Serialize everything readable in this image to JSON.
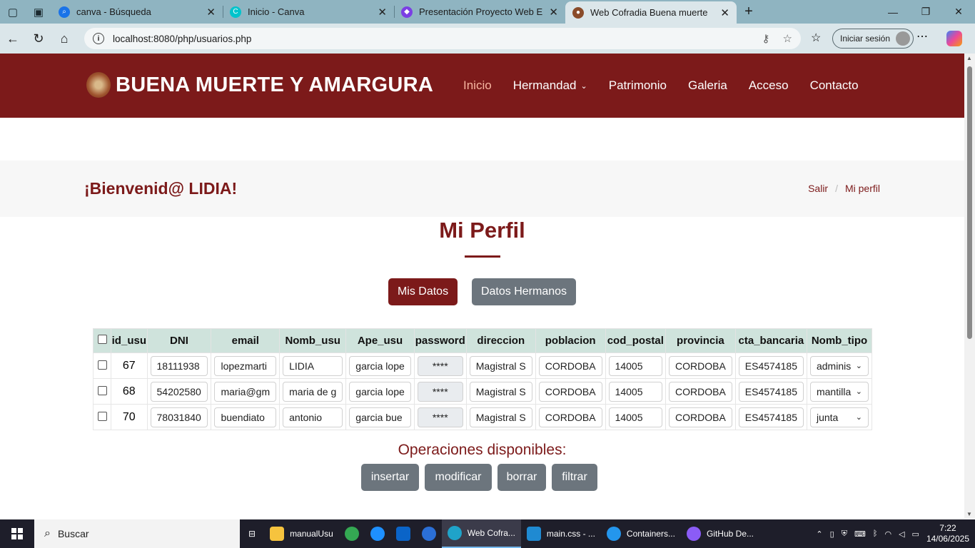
{
  "browser": {
    "tabs": [
      {
        "title": "canva - Búsqueda",
        "favicon": "search-icon",
        "color": "#1a73e8"
      },
      {
        "title": "Inicio - Canva",
        "favicon": "canva-icon",
        "color": "#00c4cc"
      },
      {
        "title": "Presentación Proyecto Web Elega",
        "favicon": "canva-presentation-icon",
        "color": "#7b3fe4"
      },
      {
        "title": "Web Cofradia Buena muerte",
        "favicon": "cofradia-icon",
        "color": "#8a4b2a"
      }
    ],
    "url": "localhost:8080/php/usuarios.php",
    "signin_label": "Iniciar sesión"
  },
  "site": {
    "brand": "BUENA MUERTE Y AMARGURA",
    "nav": [
      "Inicio",
      "Hermandad",
      "Patrimonio",
      "Galeria",
      "Acceso",
      "Contacto"
    ],
    "welcome": "¡Bienvenid@ LIDIA!",
    "breadcrumb": [
      "Salir",
      "Mi perfil"
    ],
    "page_title": "Mi Perfil",
    "tab_buttons": [
      "Mis Datos",
      "Datos Hermanos"
    ],
    "ops_title": "Operaciones disponibles:",
    "ops": [
      "insertar",
      "modificar",
      "borrar",
      "filtrar"
    ],
    "accent_color": "#7c1a1a"
  },
  "table": {
    "headers": [
      "id_usu",
      "DNI",
      "email",
      "Nomb_usu",
      "Ape_usu",
      "password",
      "direccion",
      "poblacion",
      "cod_postal",
      "provincia",
      "cta_bancaria",
      "Nomb_tipo"
    ],
    "rows": [
      {
        "id": "67",
        "dni": "18111938",
        "email": "lopezmarti",
        "nombre": "LIDIA",
        "apellido": "garcia lope",
        "password": "****",
        "direccion": "Magistral S",
        "poblacion": "CORDOBA",
        "cp": "14005",
        "provincia": "CORDOBA",
        "cuenta": "ES4574185",
        "tipo": "adminis"
      },
      {
        "id": "68",
        "dni": "54202580",
        "email": "maria@gm",
        "nombre": "maria de g",
        "apellido": "garcia lope",
        "password": "****",
        "direccion": "Magistral S",
        "poblacion": "CORDOBA",
        "cp": "14005",
        "provincia": "CORDOBA",
        "cuenta": "ES4574185",
        "tipo": "mantilla"
      },
      {
        "id": "70",
        "dni": "78031840",
        "email": "buendiato",
        "nombre": "antonio",
        "apellido": "garcia bue",
        "password": "****",
        "direccion": "Magistral S",
        "poblacion": "CORDOBA",
        "cp": "14005",
        "provincia": "CORDOBA",
        "cuenta": "ES4574185",
        "tipo": "junta"
      }
    ]
  },
  "taskbar": {
    "search_label": "Buscar",
    "apps": [
      {
        "label": "manualUsu",
        "icon": "folder-icon",
        "color": "#f6c33e"
      },
      {
        "label": "",
        "icon": "chrome-icon",
        "color": "#34a853"
      },
      {
        "label": "",
        "icon": "ie-icon",
        "color": "#1e90ff"
      },
      {
        "label": "",
        "icon": "outlook-icon",
        "color": "#0a64c8"
      },
      {
        "label": "",
        "icon": "browser-icon",
        "color": "#2b6fd6"
      },
      {
        "label": "Web Cofra...",
        "icon": "edge-icon",
        "color": "#1fa3c9"
      },
      {
        "label": "main.css - ...",
        "icon": "vscode-icon",
        "color": "#1f8ad2"
      },
      {
        "label": "Containers...",
        "icon": "docker-icon",
        "color": "#2496ed"
      },
      {
        "label": "GitHub De...",
        "icon": "github-icon",
        "color": "#8b5cf6"
      }
    ],
    "time": "7:22",
    "date": "14/06/2025"
  }
}
